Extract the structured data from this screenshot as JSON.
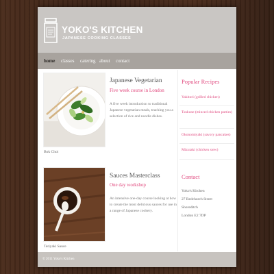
{
  "header": {
    "title": "YOKO'S KITCHEN",
    "subtitle": "JAPANESE COOKING CLASSES",
    "logo_icon": "spice-jar-icon"
  },
  "nav": {
    "items": [
      {
        "label": "home",
        "active": true
      },
      {
        "label": "classes",
        "active": false
      },
      {
        "label": "catering",
        "active": false
      },
      {
        "label": "about",
        "active": false
      },
      {
        "label": "contact",
        "active": false
      }
    ]
  },
  "courses": [
    {
      "title": "Japanese Vegetarian",
      "subtitle": "Five week course in London",
      "description": "A five week introduction to traditional Japanese vegetarian meals, teaching you a selection of rice and noodle dishes.",
      "image_caption": "Bok Choi"
    },
    {
      "title": "Sauces Masterclass",
      "subtitle": "One day workshop",
      "description": "An intensive one-day course looking at how to create the most delicious sauces for use in a range of Japanese cookery.",
      "image_caption": "Teriyaki Sauce"
    }
  ],
  "sidebar": {
    "recipes_heading": "Popular Recipes",
    "recipes": [
      "Yakitori (grilled chicken)",
      "Tsukune (minced chicken patties)",
      "Okonomiyaki (savory pancakes)",
      "Mizutaki (chicken stew)"
    ],
    "contact_heading": "Contact",
    "address": [
      "Yoko's Kitchen",
      "27 Redchurch Street",
      "Shoreditch",
      "London E2 7DP"
    ]
  },
  "footer": {
    "text": "© 2011 Yoko's Kitchen"
  },
  "colors": {
    "accent": "#e04a7f",
    "header_bg": "#c9c6c3",
    "nav_bg": "#a8a39e",
    "background": "#3a2418"
  }
}
